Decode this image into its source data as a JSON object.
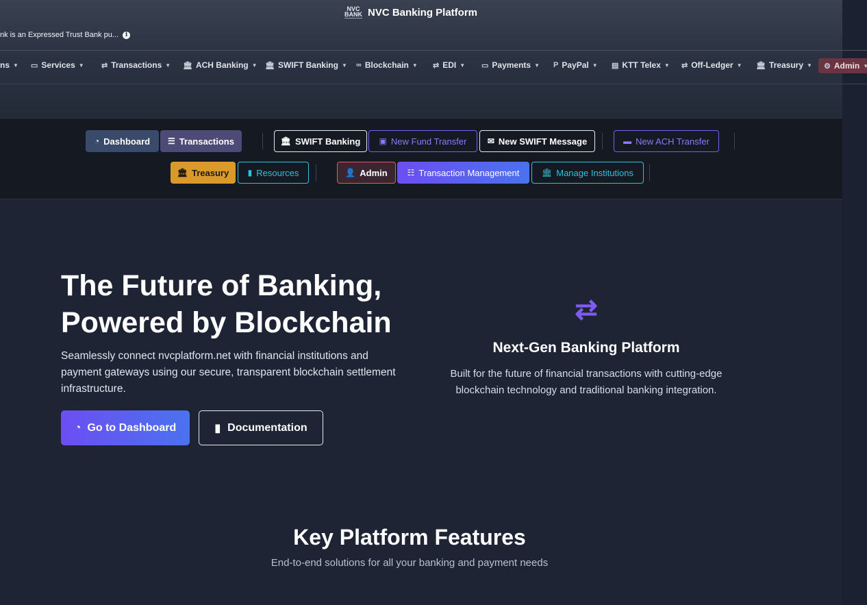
{
  "header": {
    "logo_text": "NVC\nBANK",
    "title": "NVC Banking Platform",
    "ticker": "nk is an Expressed Trust Bank pu...",
    "info_icon": "info-icon"
  },
  "menu": [
    {
      "label": "ns",
      "icon": ""
    },
    {
      "label": "Services",
      "icon": "id-card-icon"
    },
    {
      "label": "Transactions",
      "icon": "exchange-icon"
    },
    {
      "label": "ACH Banking",
      "icon": "bank-icon"
    },
    {
      "label": "SWIFT Banking",
      "icon": "bank-icon"
    },
    {
      "label": "Blockchain",
      "icon": "link-icon"
    },
    {
      "label": "EDI",
      "icon": "exchange-icon"
    },
    {
      "label": "Payments",
      "icon": "id-card-icon"
    },
    {
      "label": "PayPal",
      "icon": "paypal-icon"
    },
    {
      "label": "KTT Telex",
      "icon": "fax-icon"
    },
    {
      "label": "Off-Ledger",
      "icon": "exchange-icon"
    },
    {
      "label": "Treasury",
      "icon": "bank-icon"
    },
    {
      "label": "Admin",
      "icon": "gear-icon"
    }
  ],
  "quickbar": {
    "dashboard": "Dashboard",
    "transactions": "Transactions",
    "swift_banking": "SWIFT Banking",
    "new_fund_transfer": "New Fund Transfer",
    "new_swift_message": "New SWIFT Message",
    "new_ach_transfer": "New ACH Transfer",
    "treasury": "Treasury",
    "resources": "Resources",
    "admin": "Admin",
    "transaction_management": "Transaction Management",
    "manage_institutions": "Manage Institutions"
  },
  "hero": {
    "title_line1": "The Future of Banking,",
    "title_line2": "Powered by Blockchain",
    "lead": "Seamlessly connect nvcplatform.net with financial institutions and payment gateways using our secure, transparent blockchain settlement infrastructure.",
    "primary_button": "Go to Dashboard",
    "secondary_button": "Documentation"
  },
  "feature_card": {
    "icon": "exchange-icon",
    "title": "Next-Gen Banking Platform",
    "text": "Built for the future of financial transactions with cutting-edge blockchain technology and traditional banking integration."
  },
  "features": {
    "title": "Key Platform Features",
    "subtitle": "End-to-end solutions for all your banking and payment needs"
  },
  "colors": {
    "accent_purple": "#7c5cf2",
    "accent_blue": "#4a72ef",
    "treasury_gold": "#d99a2b",
    "teal": "#31c3d6",
    "admin_red": "#e05a6a",
    "background": "#1e2433"
  }
}
